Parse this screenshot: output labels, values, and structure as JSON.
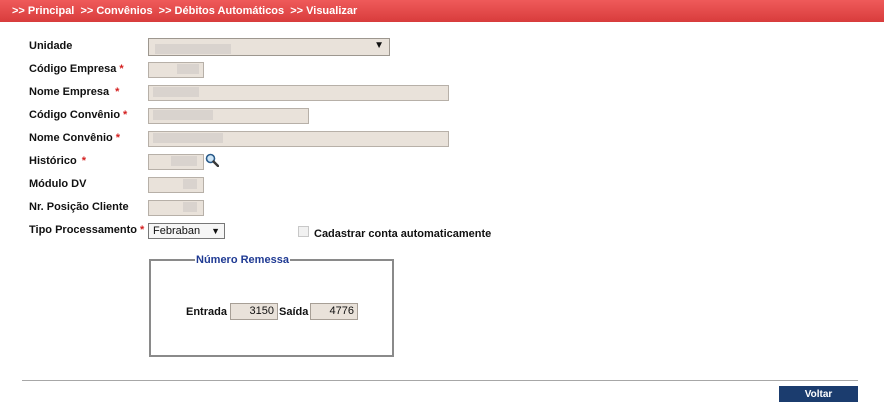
{
  "breadcrumb": {
    "items": [
      ">> Principal",
      ">> Convênios",
      ">> Débitos Automáticos",
      ">> Visualizar"
    ]
  },
  "form": {
    "unidade_label": "Unidade",
    "codigo_empresa_label": "Código Empresa",
    "nome_empresa_label": "Nome Empresa",
    "codigo_convenio_label": "Código Convênio",
    "nome_convenio_label": "Nome Convênio",
    "historico_label": "Histórico",
    "modulo_dv_label": "Módulo DV",
    "posicao_cliente_label": "Nr. Posição Cliente",
    "tipo_processamento_label": "Tipo Processamento",
    "tipo_processamento_value": "Febraban",
    "required_mark": "*",
    "cadastrar_label": "Cadastrar conta automaticamente"
  },
  "numero_remessa": {
    "legend": "Número Remessa",
    "entrada_label": "Entrada",
    "entrada_value": "3150",
    "saida_label": "Saída",
    "saida_value": "4776"
  },
  "actions": {
    "voltar_label": "Voltar"
  },
  "colors": {
    "header": "#e04848",
    "field_bg": "#e9e2da",
    "button": "#1b3c6e",
    "legend": "#1f3a93"
  },
  "icons": {
    "lookup": "magnifier-icon",
    "dropdown": "triangle-down-icon"
  }
}
